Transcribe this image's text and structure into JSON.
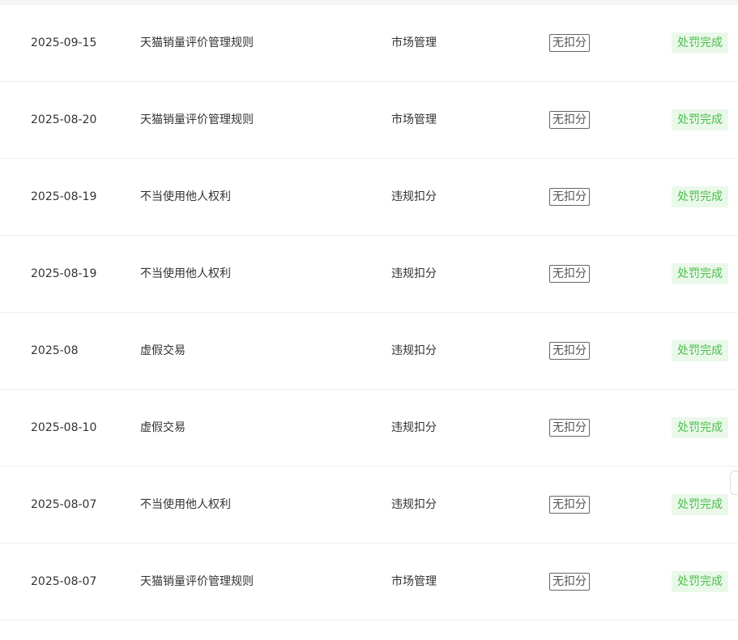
{
  "table": {
    "rows": [
      {
        "date": "2025-09-15",
        "rule": "天猫销量评价管理规则",
        "category": "市场管理",
        "deduction": "无扣分",
        "status": "处罚完成"
      },
      {
        "date": "2025-08-20",
        "rule": "天猫销量评价管理规则",
        "category": "市场管理",
        "deduction": "无扣分",
        "status": "处罚完成"
      },
      {
        "date": "2025-08-19",
        "rule": "不当使用他人权利",
        "category": "违规扣分",
        "deduction": "无扣分",
        "status": "处罚完成"
      },
      {
        "date": "2025-08-19",
        "rule": "不当使用他人权利",
        "category": "违规扣分",
        "deduction": "无扣分",
        "status": "处罚完成"
      },
      {
        "date": "2025-08",
        "rule": "虚假交易",
        "category": "违规扣分",
        "deduction": "无扣分",
        "status": "处罚完成"
      },
      {
        "date": "2025-08-10",
        "rule": "虚假交易",
        "category": "违规扣分",
        "deduction": "无扣分",
        "status": "处罚完成"
      },
      {
        "date": "2025-08-07",
        "rule": "不当使用他人权利",
        "category": "违规扣分",
        "deduction": "无扣分",
        "status": "处罚完成"
      },
      {
        "date": "2025-08-07",
        "rule": "天猫销量评价管理规则",
        "category": "市场管理",
        "deduction": "无扣分",
        "status": "处罚完成"
      }
    ]
  },
  "colors": {
    "status_text": "#4cbf4c",
    "status_bg": "#eaf8ea",
    "divider": "#eeeeee"
  }
}
